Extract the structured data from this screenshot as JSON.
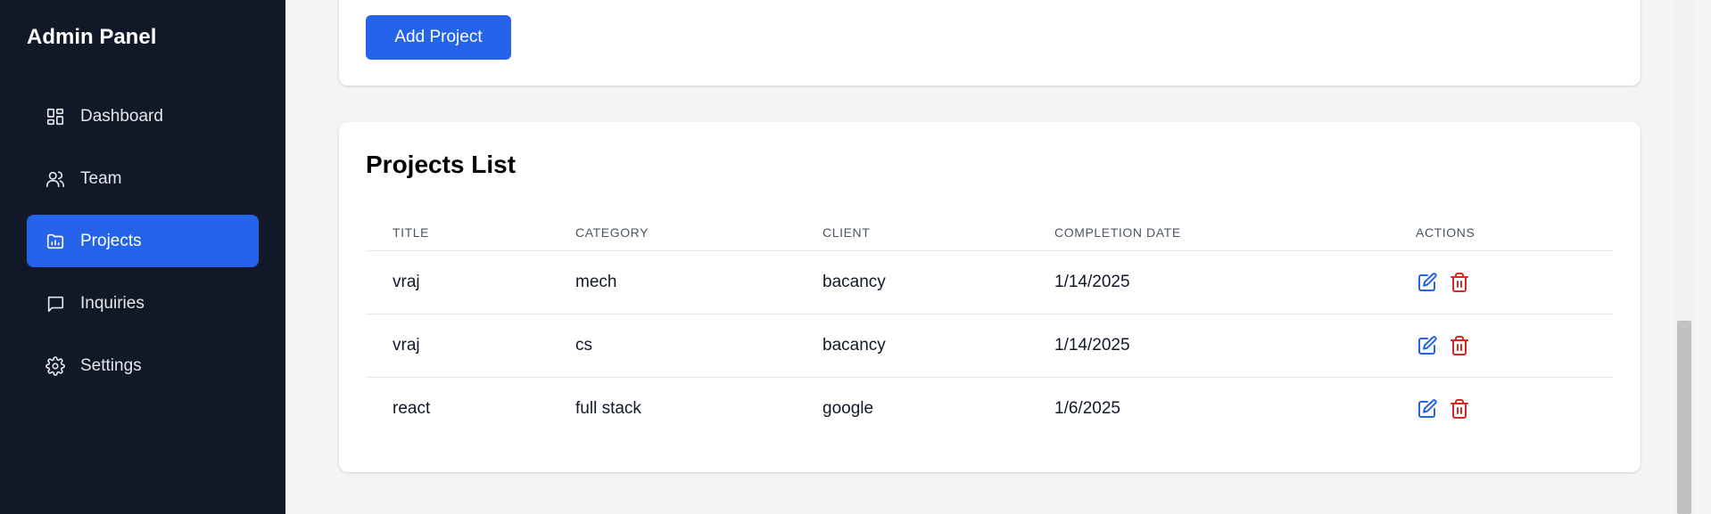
{
  "sidebar": {
    "brand": "Admin Panel",
    "items": [
      {
        "label": "Dashboard",
        "icon": "dashboard-icon",
        "active": false
      },
      {
        "label": "Team",
        "icon": "users-icon",
        "active": false
      },
      {
        "label": "Projects",
        "icon": "folder-chart-icon",
        "active": true
      },
      {
        "label": "Inquiries",
        "icon": "message-square-icon",
        "active": false
      },
      {
        "label": "Settings",
        "icon": "gear-icon",
        "active": false
      }
    ]
  },
  "main": {
    "add_button_label": "Add Project",
    "list_title": "Projects List",
    "table": {
      "headers": [
        "TITLE",
        "CATEGORY",
        "CLIENT",
        "COMPLETION DATE",
        "ACTIONS"
      ],
      "rows": [
        {
          "title": "vraj",
          "category": "mech",
          "client": "bacancy",
          "date": "1/14/2025"
        },
        {
          "title": "vraj",
          "category": "cs",
          "client": "bacancy",
          "date": "1/14/2025"
        },
        {
          "title": "react",
          "category": "full stack",
          "client": "google",
          "date": "1/6/2025"
        }
      ]
    }
  },
  "colors": {
    "sidebar_bg": "#111827",
    "accent": "#2563eb",
    "edit_icon": "#2563eb",
    "delete_icon": "#dc2626",
    "page_bg": "#f3f4f6"
  }
}
